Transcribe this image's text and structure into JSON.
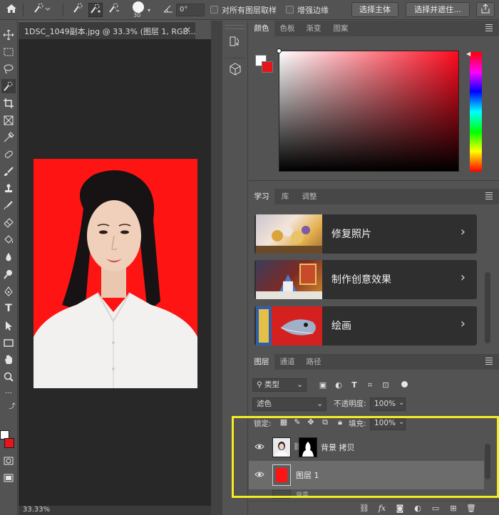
{
  "options_bar": {
    "brush_size": "30",
    "angle_value": "0°",
    "sample_all_layers_label": "对所有图层取样",
    "enhance_edge_label": "增强边缘",
    "select_subject_label": "选择主体",
    "select_and_mask_label": "选择并遮住..."
  },
  "document": {
    "tab_title": "1DSC_1049副本.jpg @ 33.3% (图层 1, RGB...",
    "zoom_status": "33.33%",
    "backdrop_color": "#ff1414"
  },
  "color_panel": {
    "tabs": [
      "颜色",
      "色板",
      "渐变",
      "图案"
    ],
    "hue_color": "#ff0b1f",
    "foreground_color": "#ffffff",
    "background_color": "#e8141b"
  },
  "learn_panel": {
    "tabs": [
      "学习",
      "库",
      "调整"
    ],
    "cards": [
      {
        "label": "修复照片",
        "icon": "chevron-right-icon"
      },
      {
        "label": "制作创意效果",
        "icon": "chevron-right-icon"
      },
      {
        "label": "绘画",
        "icon": "chevron-right-icon"
      }
    ]
  },
  "layers_panel": {
    "tabs": [
      "图层",
      "通道",
      "路径"
    ],
    "filter_kind": "类型",
    "blend_mode": "滤色",
    "opacity_label": "不透明度:",
    "opacity_value": "100%",
    "lock_label": "锁定:",
    "fill_label": "填充:",
    "fill_value": "100%",
    "layers": [
      {
        "name": "背景 拷贝",
        "visible": true,
        "has_mask": true
      },
      {
        "name": "图层 1",
        "visible": true,
        "selected": true,
        "thumb_color": "#ff1414"
      }
    ],
    "partial_layer_name": "背景"
  },
  "accent": {
    "annotation_box": "#f5ec23"
  }
}
